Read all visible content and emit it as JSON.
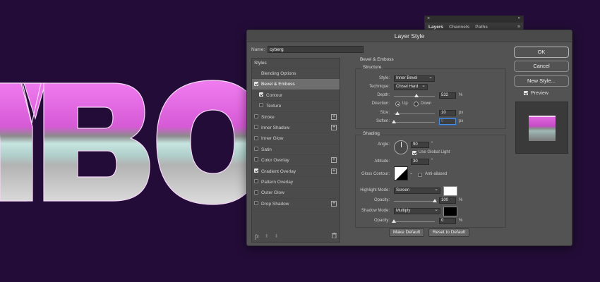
{
  "colors": {
    "background": "#230d38",
    "text_pink": "#e86ae8",
    "text_aqua": "#b9dcd7",
    "text_silver": "#c8c8c8",
    "dialog_bg": "#535353",
    "focus_blue": "#4c8fe0"
  },
  "layers_panel": {
    "tabs": [
      "Layers",
      "Channels",
      "Paths"
    ],
    "close_glyph": "×",
    "collapse_glyph": "«",
    "menu_glyph": "≡"
  },
  "dialog": {
    "title": "Layer Style",
    "name_label": "Name:",
    "name_value": "cyberg"
  },
  "styles": {
    "header": "Styles",
    "items": [
      {
        "label": "Blending Options",
        "checkbox": "none",
        "plus": false,
        "selected": false,
        "indent": false
      },
      {
        "label": "Bevel & Emboss",
        "checkbox": "on",
        "plus": false,
        "selected": true,
        "indent": false
      },
      {
        "label": "Contour",
        "checkbox": "on",
        "plus": false,
        "selected": false,
        "indent": true
      },
      {
        "label": "Texture",
        "checkbox": "off",
        "plus": false,
        "selected": false,
        "indent": true
      },
      {
        "label": "Stroke",
        "checkbox": "off",
        "plus": true,
        "selected": false,
        "indent": false
      },
      {
        "label": "Inner Shadow",
        "checkbox": "off",
        "plus": true,
        "selected": false,
        "indent": false
      },
      {
        "label": "Inner Glow",
        "checkbox": "off",
        "plus": false,
        "selected": false,
        "indent": false
      },
      {
        "label": "Satin",
        "checkbox": "off",
        "plus": false,
        "selected": false,
        "indent": false
      },
      {
        "label": "Color Overlay",
        "checkbox": "off",
        "plus": true,
        "selected": false,
        "indent": false
      },
      {
        "label": "Gradient Overlay",
        "checkbox": "on",
        "plus": true,
        "selected": false,
        "indent": false
      },
      {
        "label": "Pattern Overlay",
        "checkbox": "off",
        "plus": false,
        "selected": false,
        "indent": false
      },
      {
        "label": "Outer Glow",
        "checkbox": "off",
        "plus": false,
        "selected": false,
        "indent": false
      },
      {
        "label": "Drop Shadow",
        "checkbox": "off",
        "plus": true,
        "selected": false,
        "indent": false
      }
    ],
    "footer": {
      "fx": "fx",
      "up": "⬆",
      "down": "⬇",
      "trash": "🗑"
    }
  },
  "bevel": {
    "title": "Bevel & Emboss",
    "structure": {
      "title": "Structure",
      "style_label": "Style:",
      "style_value": "Inner Bevel",
      "technique_label": "Technique:",
      "technique_value": "Chisel Hard",
      "depth_label": "Depth:",
      "depth_value": "532",
      "depth_unit": "%",
      "depth_level": 0.55,
      "direction_label": "Direction:",
      "direction_up": "Up",
      "direction_down": "Down",
      "direction_selected": "Up",
      "size_label": "Size:",
      "size_value": "10",
      "size_unit": "px",
      "size_level": 0.08,
      "soften_label": "Soften:",
      "soften_value": "0",
      "soften_unit": "px",
      "soften_level": 0
    },
    "shading": {
      "title": "Shading",
      "angle_label": "Angle:",
      "angle_value": "90",
      "angle_unit": "°",
      "global_light_label": "Use Global Light",
      "global_light_checked": true,
      "altitude_label": "Altitude:",
      "altitude_value": "30",
      "altitude_unit": "°",
      "gloss_label": "Gloss Contour:",
      "anti_aliased_label": "Anti-aliased",
      "anti_aliased_checked": false,
      "highlight_mode_label": "Highlight Mode:",
      "highlight_mode_value": "Screen",
      "highlight_color": "#ffffff",
      "highlight_opacity_label": "Opacity:",
      "highlight_opacity_value": "100",
      "highlight_opacity_unit": "%",
      "highlight_opacity_level": 1.0,
      "shadow_mode_label": "Shadow Mode:",
      "shadow_mode_value": "Multiply",
      "shadow_color": "#000000",
      "shadow_opacity_label": "Opacity:",
      "shadow_opacity_value": "0",
      "shadow_opacity_unit": "%",
      "shadow_opacity_level": 0
    },
    "make_default": "Make Default",
    "reset_default": "Reset to Default"
  },
  "actions": {
    "ok": "OK",
    "cancel": "Cancel",
    "new_style": "New Style...",
    "preview_label": "Preview",
    "preview_checked": true
  }
}
